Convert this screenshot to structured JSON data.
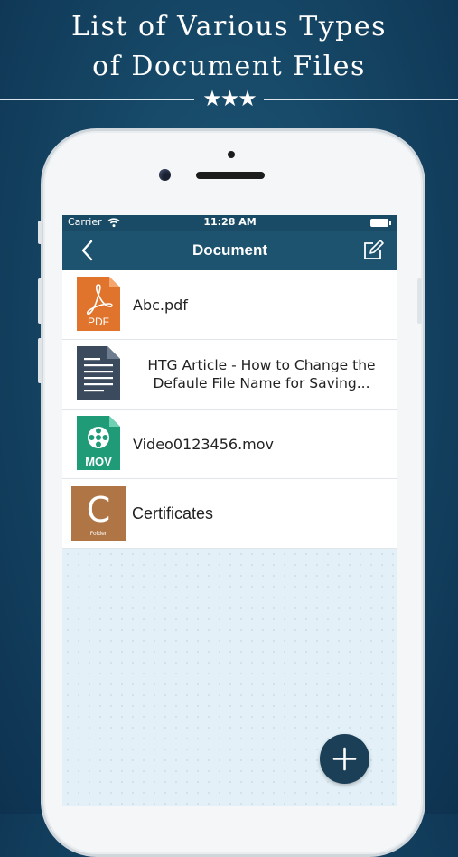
{
  "promo": {
    "title_line1": "List of Various Types",
    "title_line2": "of Document Files",
    "stars": "★★★"
  },
  "statusbar": {
    "carrier": "Carrier",
    "time": "11:28 AM"
  },
  "navbar": {
    "title": "Document",
    "back_icon": "chevron-left-icon",
    "edit_icon": "compose-icon"
  },
  "files": [
    {
      "name": "Abc.pdf",
      "type_badge": "PDF",
      "icon": "pdf-file-icon",
      "color": "#e0742c"
    },
    {
      "name_line1": "HTG Article - How to Change the",
      "name_line2": "Defaule File Name for Saving...",
      "icon": "text-document-icon",
      "color": "#3b4a5c"
    },
    {
      "name": "Video0123456.mov",
      "type_badge": "MOV",
      "icon": "video-file-icon",
      "color": "#1f9b78"
    },
    {
      "name": "Certificates",
      "folder_letter": "C",
      "folder_caption": "Folder",
      "icon": "folder-icon",
      "color": "#b07545"
    }
  ],
  "fab": {
    "icon": "plus-icon"
  },
  "colors": {
    "background": "#164766",
    "navbar": "#1e5370",
    "empty_area": "#e3f0f8",
    "fab": "#1b3f56"
  }
}
